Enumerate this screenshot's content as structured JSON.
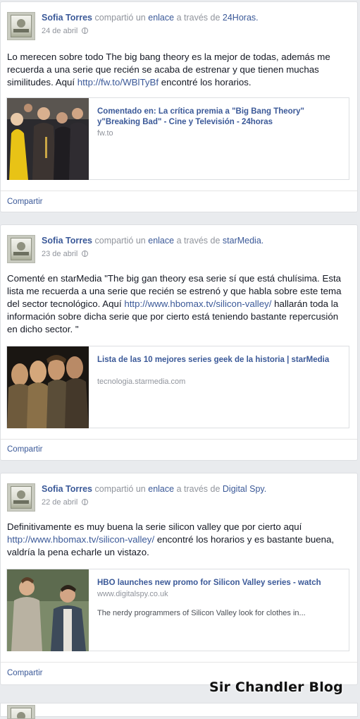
{
  "posts": [
    {
      "author": "Sofia Torres",
      "verb": "compartió un",
      "object": "enlace",
      "via": "a través de",
      "source": "24Horas.",
      "date": "24 de abril",
      "text_before": "Lo merecen sobre todo The big bang theory es la mejor de todas, además me recuerda a una serie que recién se acaba de estrenar y que tienen muchas similitudes. Aquí ",
      "link": "http://fw.to/WBlTyBf",
      "text_after": " encontré los horarios.",
      "card": {
        "title": "Comentado en: La crítica premia a \"Big Bang Theory\" y\"Breaking Bad\" - Cine y Televisión - 24horas",
        "domain": "fw.to",
        "description": ""
      },
      "share": "Compartir"
    },
    {
      "author": "Sofia Torres",
      "verb": "compartió un",
      "object": "enlace",
      "via": "a través de",
      "source": "starMedia.",
      "date": "23 de abril",
      "text_before": "Comenté en starMedia \"The big gan theory esa serie sí que está chulísima. Esta lista me recuerda a una serie que recién se estrenó y que habla sobre este tema del sector tecnológico. Aquí ",
      "link": "http://www.hbomax.tv/silicon-valley/",
      "text_after": " hallarán toda la información sobre dicha serie que por cierto está teniendo bastante repercusión en dicho sector. \"",
      "card": {
        "title": "Lista de las 10 mejores series geek de la historia | starMedia",
        "domain": "tecnologia.starmedia.com",
        "description": ""
      },
      "share": "Compartir"
    },
    {
      "author": "Sofia Torres",
      "verb": "compartió un",
      "object": "enlace",
      "via": "a través de",
      "source": "Digital Spy.",
      "date": "22 de abril",
      "text_before": "Definitivamente es muy buena la serie silicon valley que por cierto aquí ",
      "link": "http://www.hbomax.tv/silicon-valley/",
      "text_after": " encontré los horarios y es bastante buena, valdría la pena echarle un vistazo.",
      "card": {
        "title": "HBO launches new promo for Silicon Valley series - watch",
        "domain": "www.digitalspy.co.uk",
        "description": "The nerdy programmers of Silicon Valley look for clothes in..."
      },
      "share": "Compartir"
    }
  ],
  "watermark": "Sir Chandler Blog",
  "icons": {
    "privacy": "globe-icon"
  },
  "colors": {
    "link": "#3b5998",
    "muted": "#90949c",
    "background": "#e9ebee"
  }
}
